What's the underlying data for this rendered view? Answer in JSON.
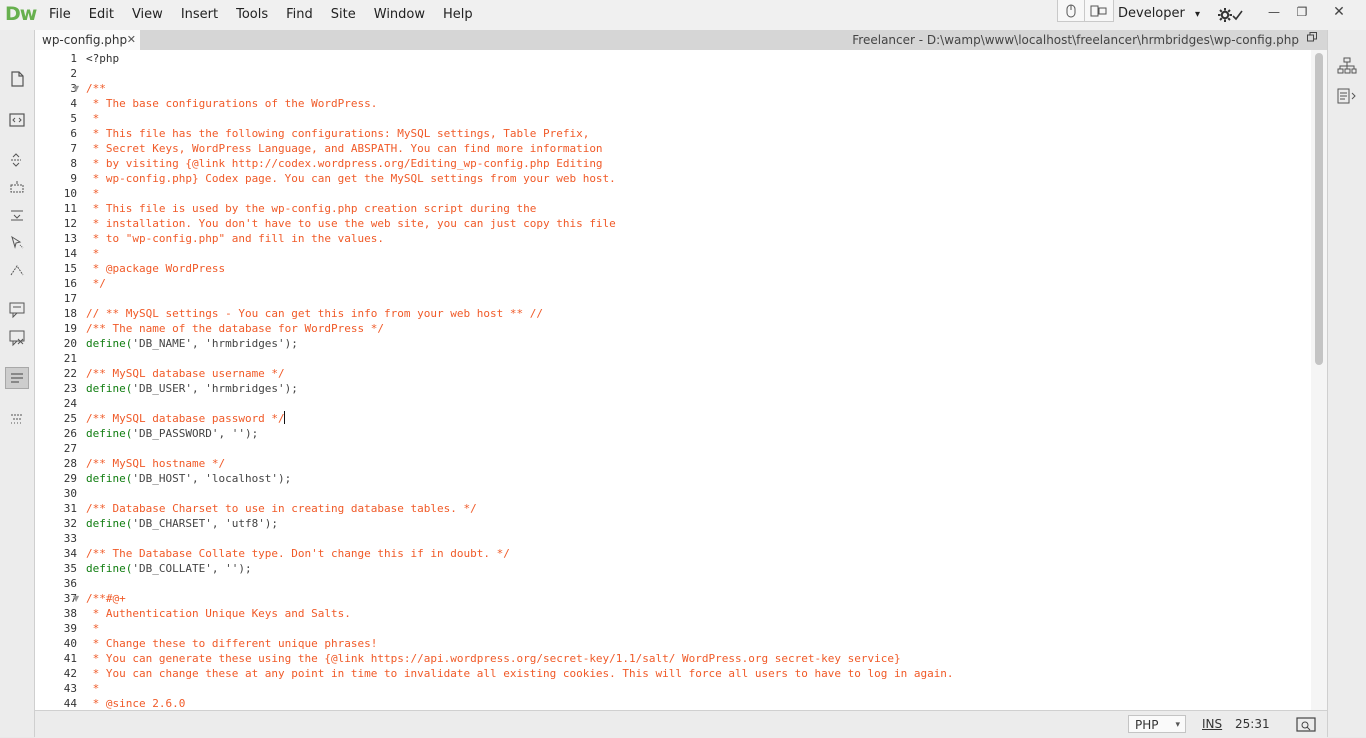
{
  "app": {
    "logo": "Dw",
    "menus": [
      "File",
      "Edit",
      "View",
      "Insert",
      "Tools",
      "Find",
      "Site",
      "Window",
      "Help"
    ],
    "workspace": "Developer",
    "workspace_arrow": "▾",
    "window_controls": {
      "minimize": "—",
      "restore": "❐",
      "close": "✕"
    }
  },
  "tab": {
    "filename": "wp-config.php",
    "close": "✕",
    "path": "Freelancer - D:\\wamp\\www\\localhost\\freelancer\\hrmbridges\\wp-config.php"
  },
  "left_toolbar": [
    "new-document-icon",
    "code-view-icon",
    "expand-all-icon",
    "collapse-selection-icon",
    "collapse-outside-icon",
    "select-parent-tag-icon",
    "balance-braces-icon",
    "apply-comment-icon",
    "remove-comment-icon",
    "word-wrap-icon",
    "format-source-icon"
  ],
  "right_panel": [
    "files-panel-icon",
    "code-inspector-icon"
  ],
  "editor": {
    "line_numbers": [
      "1",
      "2",
      "3",
      "4",
      "5",
      "6",
      "7",
      "8",
      "9",
      "10",
      "11",
      "12",
      "13",
      "14",
      "15",
      "16",
      "17",
      "18",
      "19",
      "20",
      "21",
      "22",
      "23",
      "24",
      "25",
      "26",
      "27",
      "28",
      "29",
      "30",
      "31",
      "32",
      "33",
      "34",
      "35",
      "36",
      "37",
      "38",
      "39",
      "40",
      "41",
      "42",
      "43",
      "44"
    ],
    "fold_marker": "▼",
    "lines": [
      {
        "t": "p",
        "s": "<?php"
      },
      {
        "t": "p",
        "s": ""
      },
      {
        "t": "c",
        "s": "/**"
      },
      {
        "t": "c",
        "s": " * The base configurations of the WordPress."
      },
      {
        "t": "c",
        "s": " *"
      },
      {
        "t": "c",
        "s": " * This file has the following configurations: MySQL settings, Table Prefix,"
      },
      {
        "t": "c",
        "s": " * Secret Keys, WordPress Language, and ABSPATH. You can find more information"
      },
      {
        "t": "c",
        "s": " * by visiting {@link http://codex.wordpress.org/Editing_wp-config.php Editing"
      },
      {
        "t": "c",
        "s": " * wp-config.php} Codex page. You can get the MySQL settings from your web host."
      },
      {
        "t": "c",
        "s": " *"
      },
      {
        "t": "c",
        "s": " * This file is used by the wp-config.php creation script during the"
      },
      {
        "t": "c",
        "s": " * installation. You don't have to use the web site, you can just copy this file"
      },
      {
        "t": "c",
        "s": " * to \"wp-config.php\" and fill in the values."
      },
      {
        "t": "c",
        "s": " *"
      },
      {
        "t": "c",
        "s": " * @package WordPress"
      },
      {
        "t": "c",
        "s": " */"
      },
      {
        "t": "p",
        "s": ""
      },
      {
        "t": "c",
        "s": "// ** MySQL settings - You can get this info from your web host ** //"
      },
      {
        "t": "c",
        "s": "/** The name of the database for WordPress */"
      },
      {
        "t": "d",
        "s": "'DB_NAME', 'hrmbridges');"
      },
      {
        "t": "p",
        "s": ""
      },
      {
        "t": "c",
        "s": "/** MySQL database username */"
      },
      {
        "t": "d",
        "s": "'DB_USER', 'hrmbridges');"
      },
      {
        "t": "p",
        "s": ""
      },
      {
        "t": "c",
        "s": "/** MySQL database password */"
      },
      {
        "t": "d",
        "s": "'DB_PASSWORD', '');"
      },
      {
        "t": "p",
        "s": ""
      },
      {
        "t": "c",
        "s": "/** MySQL hostname */"
      },
      {
        "t": "d",
        "s": "'DB_HOST', 'localhost');"
      },
      {
        "t": "p",
        "s": ""
      },
      {
        "t": "c",
        "s": "/** Database Charset to use in creating database tables. */"
      },
      {
        "t": "d",
        "s": "'DB_CHARSET', 'utf8');"
      },
      {
        "t": "p",
        "s": ""
      },
      {
        "t": "c",
        "s": "/** The Database Collate type. Don't change this if in doubt. */"
      },
      {
        "t": "d",
        "s": "'DB_COLLATE', '');"
      },
      {
        "t": "p",
        "s": ""
      },
      {
        "t": "c",
        "s": "/**#@+"
      },
      {
        "t": "c",
        "s": " * Authentication Unique Keys and Salts."
      },
      {
        "t": "c",
        "s": " *"
      },
      {
        "t": "c",
        "s": " * Change these to different unique phrases!"
      },
      {
        "t": "c",
        "s": " * You can generate these using the {@link https://api.wordpress.org/secret-key/1.1/salt/ WordPress.org secret-key service}"
      },
      {
        "t": "c",
        "s": " * You can change these at any point in time to invalidate all existing cookies. This will force all users to have to log in again."
      },
      {
        "t": "c",
        "s": " *"
      },
      {
        "t": "c",
        "s": " * @since 2.6.0"
      }
    ],
    "define_keyword": "define("
  },
  "status": {
    "language": "PHP",
    "language_arrow": "▾",
    "insert_mode": "INS",
    "cursor_position": "25:31"
  },
  "colors": {
    "comment": "#f05a28",
    "keyword": "#0f7d0f",
    "logo": "#67b04e"
  }
}
